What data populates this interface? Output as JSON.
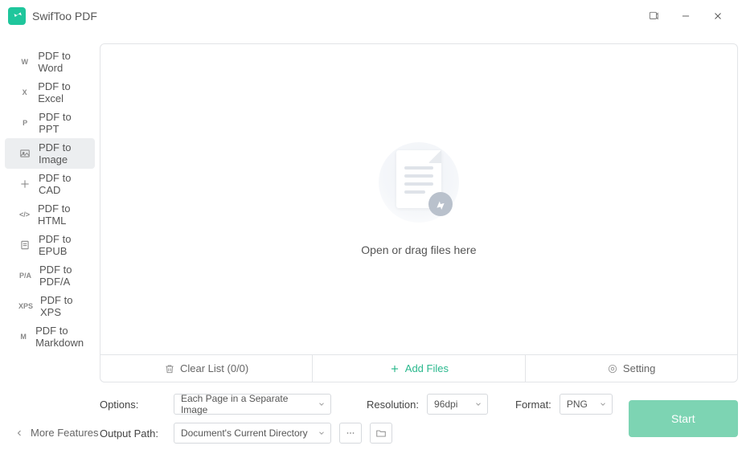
{
  "app": {
    "title": "SwifToo PDF"
  },
  "sidebar": {
    "items": [
      {
        "icon": "W",
        "label": "PDF to Word"
      },
      {
        "icon": "X",
        "label": "PDF to Excel"
      },
      {
        "icon": "P",
        "label": "PDF to PPT"
      },
      {
        "icon": "img",
        "label": "PDF to Image"
      },
      {
        "icon": "cad",
        "label": "PDF to CAD"
      },
      {
        "icon": "</>",
        "label": "PDF to HTML"
      },
      {
        "icon": "epub",
        "label": "PDF to EPUB"
      },
      {
        "icon": "P/A",
        "label": "PDF to PDF/A"
      },
      {
        "icon": "XPS",
        "label": "PDF to XPS"
      },
      {
        "icon": "M",
        "label": "PDF to Markdown"
      }
    ],
    "activeIndex": 3,
    "more": "More Features"
  },
  "drop": {
    "text": "Open or drag files here"
  },
  "toolbar": {
    "clear": "Clear List (0/0)",
    "add": "Add Files",
    "setting": "Setting"
  },
  "options": {
    "optionsLabel": "Options:",
    "optionsValue": "Each Page in a Separate Image",
    "resolutionLabel": "Resolution:",
    "resolutionValue": "96dpi",
    "formatLabel": "Format:",
    "formatValue": "PNG",
    "outputLabel": "Output Path:",
    "outputValue": "Document's Current Directory",
    "start": "Start"
  }
}
